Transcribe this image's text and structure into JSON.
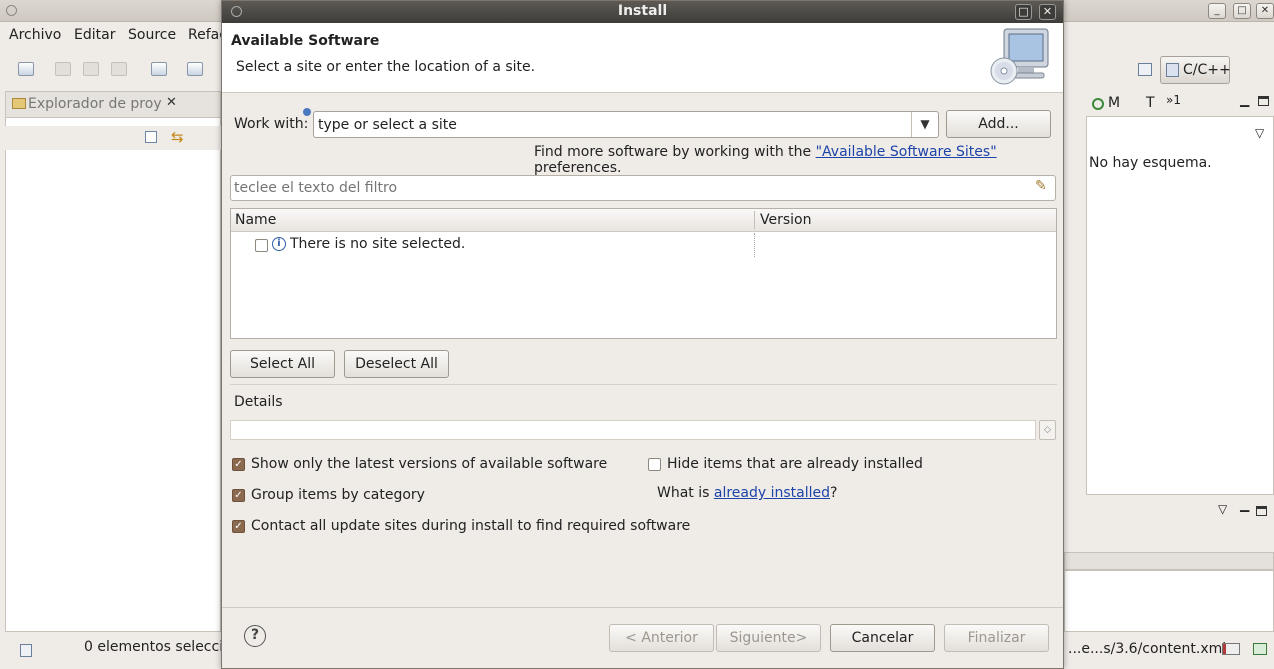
{
  "background_window": {
    "menu": [
      "Archivo",
      "Editar",
      "Source",
      "Refac"
    ],
    "left_view_tab": "Explorador de proy",
    "perspective": "C/C++",
    "right_tabs": [
      "M",
      "T",
      "»1"
    ],
    "outline_empty": "No hay esquema.",
    "status_text": "0 elementos seleccio",
    "status_right": "...e...s/3.6/content.xml"
  },
  "dialog": {
    "title": "Install",
    "header_title": "Available Software",
    "header_subtitle": "Select a site or enter the location of a site.",
    "work_with_label": "Work with:",
    "work_with_value": "type or select a site",
    "add_button": "Add...",
    "find_more_prefix": "Find more software by working with the ",
    "find_more_link": "\"Available Software Sites\"",
    "find_more_suffix": " preferences.",
    "filter_placeholder": "teclee el texto del filtro",
    "columns": [
      "Name",
      "Version"
    ],
    "rows": [
      {
        "name": "There is no site selected.",
        "version": "",
        "checked": false
      }
    ],
    "select_all": "Select All",
    "deselect_all": "Deselect All",
    "details_label": "Details",
    "options": [
      {
        "label": "Show only the latest versions of available software",
        "checked": true
      },
      {
        "label": "Group items by category",
        "checked": true
      },
      {
        "label": "Contact all update sites during install to find required software",
        "checked": true
      },
      {
        "label": "Hide items that are already installed",
        "checked": false
      }
    ],
    "what_is_prefix": "What is ",
    "what_is_link": "already installed",
    "what_is_suffix": "?",
    "buttons": {
      "back": "< Anterior",
      "next": "Siguiente>",
      "cancel": "Cancelar",
      "finish": "Finalizar"
    },
    "help_glyph": "?"
  }
}
